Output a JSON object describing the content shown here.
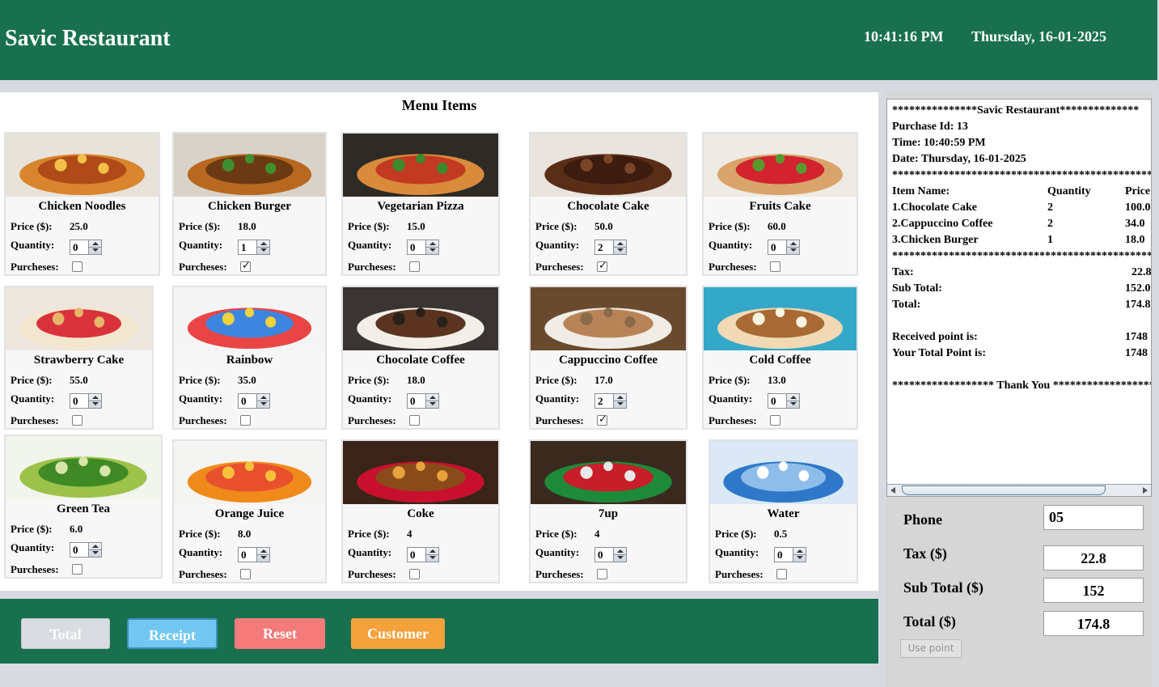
{
  "header": {
    "title": "Savic Restaurant",
    "time": "10:41:16 PM",
    "date": "Thursday, 16-01-2025"
  },
  "menu": {
    "title": "Menu Items",
    "labels": {
      "price": "Price ($):",
      "quantity": "Quantity:",
      "purchases": "Purcheses:"
    },
    "items": [
      {
        "name": "Chicken Noodles",
        "price": "25.0",
        "quantity": "0",
        "purchased": false,
        "image": "noodles-image"
      },
      {
        "name": "Chicken Burger",
        "price": "18.0",
        "quantity": "1",
        "purchased": true,
        "image": "burger-image"
      },
      {
        "name": "Vegetarian Pizza",
        "price": "15.0",
        "quantity": "0",
        "purchased": false,
        "image": "pizza-image"
      },
      {
        "name": "Chocolate Cake",
        "price": "50.0",
        "quantity": "2",
        "purchased": true,
        "image": "chocolate-cake-image"
      },
      {
        "name": "Fruits Cake",
        "price": "60.0",
        "quantity": "0",
        "purchased": false,
        "image": "fruits-cake-image"
      },
      {
        "name": "Strawberry Cake",
        "price": "55.0",
        "quantity": "0",
        "purchased": false,
        "image": "strawberry-cake-image"
      },
      {
        "name": "Rainbow",
        "price": "35.0",
        "quantity": "0",
        "purchased": false,
        "image": "rainbow-cake-image"
      },
      {
        "name": "Chocolate Coffee",
        "price": "18.0",
        "quantity": "0",
        "purchased": false,
        "image": "chocolate-coffee-image"
      },
      {
        "name": "Cappuccino Coffee",
        "price": "17.0",
        "quantity": "2",
        "purchased": true,
        "image": "cappuccino-image"
      },
      {
        "name": "Cold Coffee",
        "price": "13.0",
        "quantity": "0",
        "purchased": false,
        "image": "cold-coffee-image"
      },
      {
        "name": "Green Tea",
        "price": "6.0",
        "quantity": "0",
        "purchased": false,
        "image": "green-tea-image"
      },
      {
        "name": "Orange Juice",
        "price": "8.0",
        "quantity": "0",
        "purchased": false,
        "image": "orange-juice-image"
      },
      {
        "name": "Coke",
        "price": "4",
        "quantity": "0",
        "purchased": false,
        "image": "coke-image"
      },
      {
        "name": "7up",
        "price": "4",
        "quantity": "0",
        "purchased": false,
        "image": "7up-image"
      },
      {
        "name": "Water",
        "price": "0.5",
        "quantity": "0",
        "purchased": false,
        "image": "water-image"
      }
    ]
  },
  "buttons": {
    "total": "Total",
    "receipt": "Receipt",
    "reset": "Reset",
    "customer": "Customer",
    "colors": {
      "total": "#d9dde2",
      "receipt": "#72c7f2",
      "reset": "#f57b7b",
      "customer": "#f5a13c"
    }
  },
  "receipt": {
    "header": "***************Savic Restaurant**************",
    "purchase_id": "Purchase Id: 13",
    "time": "Time: 10:40:59 PM",
    "date": "Date: Thursday, 16-01-2025",
    "separator": "****************************************************",
    "columns": {
      "item": "Item Name:",
      "quantity": "Quantity",
      "price": "Price"
    },
    "items": [
      {
        "name": "1.Chocolate Cake",
        "quantity": "2",
        "price": "100.0"
      },
      {
        "name": "2.Cappuccino Coffee",
        "quantity": "2",
        "price": "34.0"
      },
      {
        "name": "3.Chicken Burger",
        "quantity": "1",
        "price": "18.0"
      }
    ],
    "tax_label": "Tax:",
    "tax_value": "22.8",
    "subtotal_label": "Sub Total:",
    "subtotal_value": "152.0",
    "total_label": "Total:",
    "total_value": "174.8",
    "received_label": "Received point is:",
    "received_value": "1748",
    "total_point_label": "Your Total Point is:",
    "total_point_value": "1748",
    "thanks": "****************** Thank You ******************"
  },
  "summary": {
    "phone_label": "Phone",
    "phone_value": "05",
    "tax_label": "Tax ($)",
    "tax_value": "22.8",
    "subtotal_label": "Sub Total ($)",
    "subtotal_value": "152",
    "total_label": "Total ($)",
    "total_value": "174.8",
    "use_point": "Use point"
  },
  "colors": {
    "brand": "#18704e",
    "background": "#d7dbe1"
  }
}
